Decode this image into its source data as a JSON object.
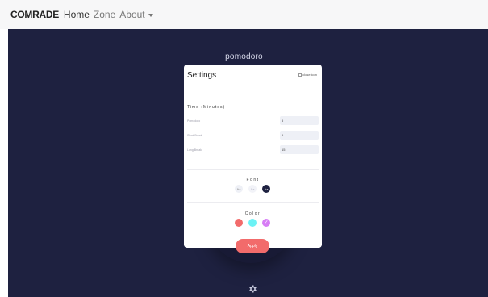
{
  "navbar": {
    "brand": "COMRADE",
    "links": [
      "Home",
      "Zone",
      "About"
    ]
  },
  "app": {
    "title": "pomodoro"
  },
  "settings": {
    "title": "Settings",
    "close_alt": "close icon",
    "time_section": "Time (Minutes)",
    "fields": [
      {
        "label": "Pomodoro",
        "value": "5"
      },
      {
        "label": "Short Break",
        "value": "5"
      },
      {
        "label": "Long Break",
        "value": "15"
      }
    ],
    "font_section": "Font",
    "font_options": [
      {
        "label": "Aa",
        "selected": false
      },
      {
        "label": "Aa",
        "selected": false
      },
      {
        "label": "Aa",
        "selected": true
      }
    ],
    "color_section": "Color",
    "color_options": [
      {
        "hex": "#f26b6b",
        "selected": false
      },
      {
        "hex": "#6cf2f5",
        "selected": false
      },
      {
        "hex": "#d77df5",
        "selected": true
      }
    ],
    "apply_label": "Apply"
  },
  "colors": {
    "background": "#1e2140",
    "accent": "#f26b6b"
  }
}
